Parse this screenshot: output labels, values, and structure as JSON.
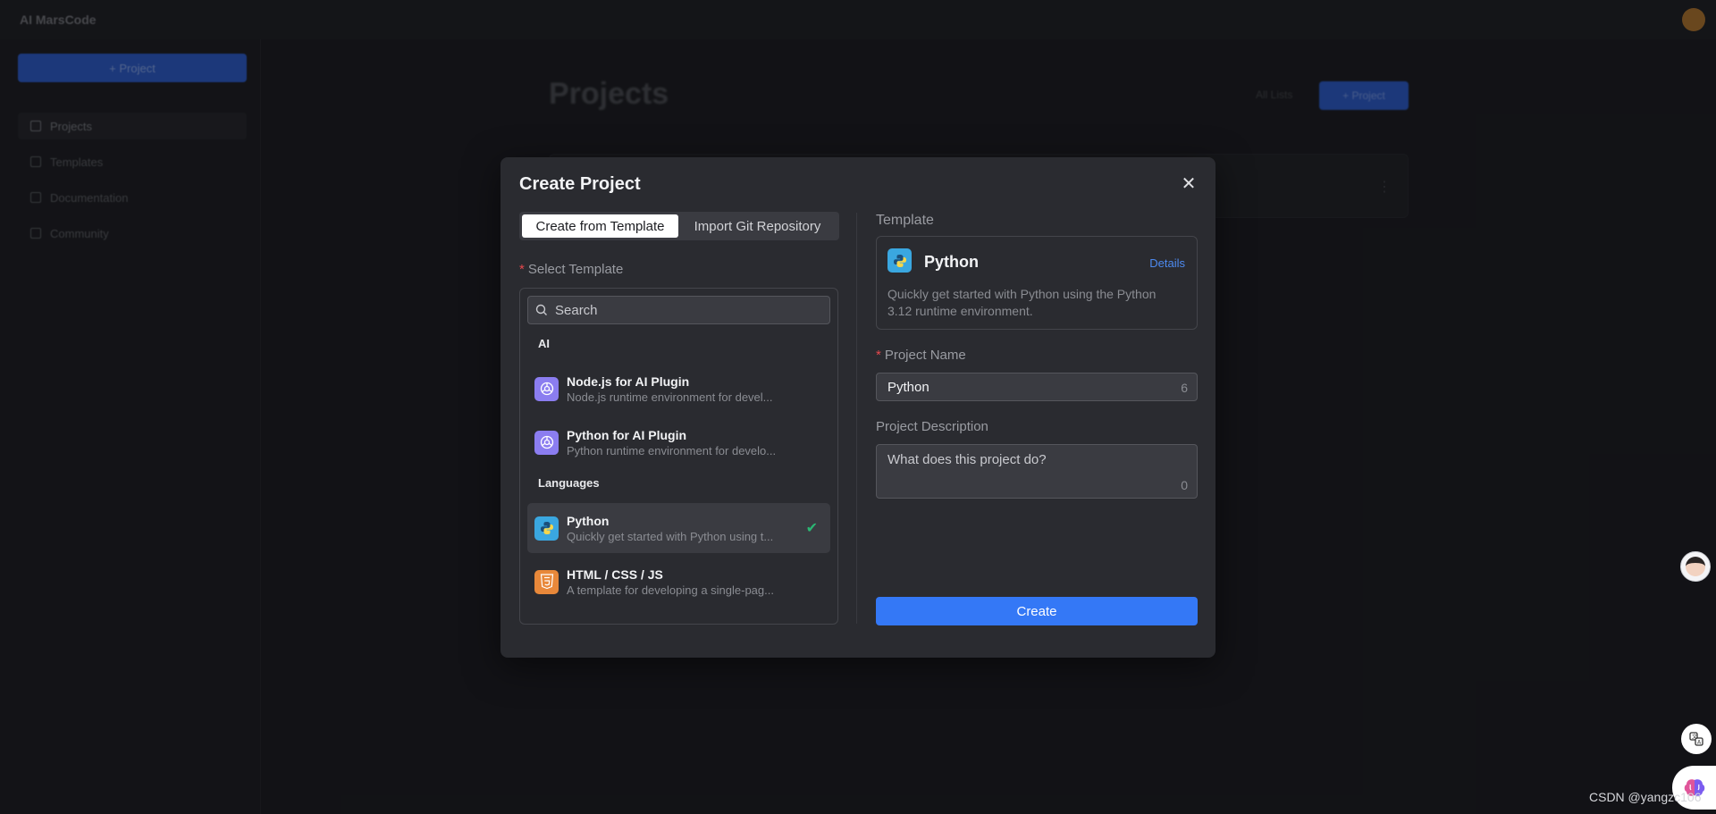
{
  "background": {
    "brand": "AI MarsCode",
    "sidebar": {
      "new_button": "+ Project",
      "items": [
        {
          "label": "Projects"
        },
        {
          "label": "Templates"
        },
        {
          "label": "Documentation"
        },
        {
          "label": "Community"
        }
      ]
    },
    "main": {
      "title": "Projects",
      "link": "All Lists",
      "button": "+ Project"
    }
  },
  "modal": {
    "title": "Create Project",
    "tabs": [
      {
        "label": "Create from Template",
        "active": true
      },
      {
        "label": "Import Git Repository",
        "active": false
      }
    ],
    "select_template_label": "Select Template",
    "search_placeholder": "Search",
    "groups": [
      {
        "heading": "AI",
        "items": [
          {
            "name": "Node.js for AI Plugin",
            "desc": "Node.js runtime environment for devel...",
            "icon": "openai-icon"
          },
          {
            "name": "Python for AI Plugin",
            "desc": "Python runtime environment for develo...",
            "icon": "openai-icon"
          }
        ]
      },
      {
        "heading": "Languages",
        "items": [
          {
            "name": "Python",
            "desc": "Quickly get started with Python using t...",
            "icon": "python-icon",
            "selected": true
          },
          {
            "name": "HTML / CSS / JS",
            "desc": "A template for developing a single-pag...",
            "icon": "html5-icon"
          }
        ]
      }
    ],
    "template_section_label": "Template",
    "selected_template": {
      "name": "Python",
      "details_link": "Details",
      "description": "Quickly get started with Python using the Python 3.12 runtime environment."
    },
    "project_name_label": "Project Name",
    "project_name_value": "Python",
    "project_name_count": "6",
    "project_desc_label": "Project Description",
    "project_desc_placeholder": "What does this project do?",
    "project_desc_count": "0",
    "create_button": "Create"
  },
  "watermark": "CSDN @yangzc106",
  "colors": {
    "accent": "#3478f6",
    "selected_check": "#2bb673",
    "required": "#e5484d",
    "modal_bg": "#2a2b30"
  }
}
